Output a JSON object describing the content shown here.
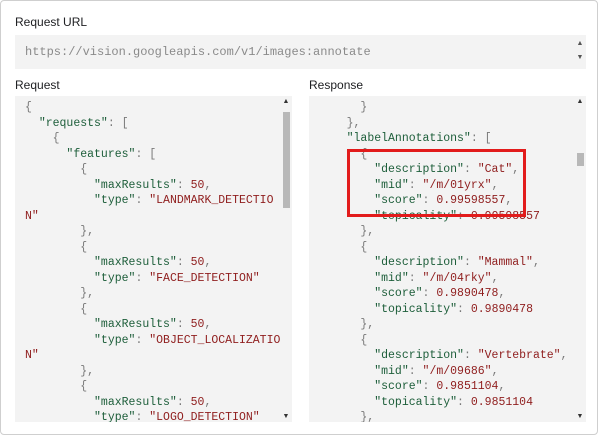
{
  "url_section": {
    "heading": "Request URL",
    "value": "https://vision.googleapis.com/v1/images:annotate"
  },
  "request_section": {
    "heading": "Request",
    "lines": [
      [
        {
          "t": "p",
          "v": "{"
        }
      ],
      [
        {
          "t": "p",
          "v": "  "
        },
        {
          "t": "k",
          "v": "\"requests\""
        },
        {
          "t": "p",
          "v": ": ["
        }
      ],
      [
        {
          "t": "p",
          "v": "    {"
        }
      ],
      [
        {
          "t": "p",
          "v": "      "
        },
        {
          "t": "k",
          "v": "\"features\""
        },
        {
          "t": "p",
          "v": ": ["
        }
      ],
      [
        {
          "t": "p",
          "v": "        {"
        }
      ],
      [
        {
          "t": "p",
          "v": "          "
        },
        {
          "t": "k",
          "v": "\"maxResults\""
        },
        {
          "t": "p",
          "v": ": "
        },
        {
          "t": "n",
          "v": "50"
        },
        {
          "t": "p",
          "v": ","
        }
      ],
      [
        {
          "t": "p",
          "v": "          "
        },
        {
          "t": "k",
          "v": "\"type\""
        },
        {
          "t": "p",
          "v": ": "
        },
        {
          "t": "s",
          "v": "\"LANDMARK_DETECTIO"
        }
      ],
      [
        {
          "t": "s",
          "v": "N\""
        }
      ],
      [
        {
          "t": "p",
          "v": "        },"
        }
      ],
      [
        {
          "t": "p",
          "v": "        {"
        }
      ],
      [
        {
          "t": "p",
          "v": "          "
        },
        {
          "t": "k",
          "v": "\"maxResults\""
        },
        {
          "t": "p",
          "v": ": "
        },
        {
          "t": "n",
          "v": "50"
        },
        {
          "t": "p",
          "v": ","
        }
      ],
      [
        {
          "t": "p",
          "v": "          "
        },
        {
          "t": "k",
          "v": "\"type\""
        },
        {
          "t": "p",
          "v": ": "
        },
        {
          "t": "s",
          "v": "\"FACE_DETECTION\""
        }
      ],
      [
        {
          "t": "p",
          "v": "        },"
        }
      ],
      [
        {
          "t": "p",
          "v": "        {"
        }
      ],
      [
        {
          "t": "p",
          "v": "          "
        },
        {
          "t": "k",
          "v": "\"maxResults\""
        },
        {
          "t": "p",
          "v": ": "
        },
        {
          "t": "n",
          "v": "50"
        },
        {
          "t": "p",
          "v": ","
        }
      ],
      [
        {
          "t": "p",
          "v": "          "
        },
        {
          "t": "k",
          "v": "\"type\""
        },
        {
          "t": "p",
          "v": ": "
        },
        {
          "t": "s",
          "v": "\"OBJECT_LOCALIZATIO"
        }
      ],
      [
        {
          "t": "s",
          "v": "N\""
        }
      ],
      [
        {
          "t": "p",
          "v": "        },"
        }
      ],
      [
        {
          "t": "p",
          "v": "        {"
        }
      ],
      [
        {
          "t": "p",
          "v": "          "
        },
        {
          "t": "k",
          "v": "\"maxResults\""
        },
        {
          "t": "p",
          "v": ": "
        },
        {
          "t": "n",
          "v": "50"
        },
        {
          "t": "p",
          "v": ","
        }
      ],
      [
        {
          "t": "p",
          "v": "          "
        },
        {
          "t": "k",
          "v": "\"type\""
        },
        {
          "t": "p",
          "v": ": "
        },
        {
          "t": "s",
          "v": "\"LOGO_DETECTION\""
        }
      ]
    ]
  },
  "response_section": {
    "heading": "Response",
    "lines": [
      [
        {
          "t": "p",
          "v": "      }"
        }
      ],
      [
        {
          "t": "p",
          "v": "    },"
        }
      ],
      [
        {
          "t": "p",
          "v": "    "
        },
        {
          "t": "k",
          "v": "\"labelAnnotations\""
        },
        {
          "t": "p",
          "v": ": ["
        }
      ],
      [
        {
          "t": "p",
          "v": "      {"
        }
      ],
      [
        {
          "t": "p",
          "v": "        "
        },
        {
          "t": "k",
          "v": "\"description\""
        },
        {
          "t": "p",
          "v": ": "
        },
        {
          "t": "s",
          "v": "\"Cat\""
        },
        {
          "t": "p",
          "v": ","
        }
      ],
      [
        {
          "t": "p",
          "v": "        "
        },
        {
          "t": "k",
          "v": "\"mid\""
        },
        {
          "t": "p",
          "v": ": "
        },
        {
          "t": "s",
          "v": "\"/m/01yrx\""
        },
        {
          "t": "p",
          "v": ","
        }
      ],
      [
        {
          "t": "p",
          "v": "        "
        },
        {
          "t": "k",
          "v": "\"score\""
        },
        {
          "t": "p",
          "v": ": "
        },
        {
          "t": "n",
          "v": "0.99598557"
        },
        {
          "t": "p",
          "v": ","
        }
      ],
      [
        {
          "t": "p",
          "v": "        "
        },
        {
          "t": "k",
          "v": "\"topicality\""
        },
        {
          "t": "p",
          "v": ": "
        },
        {
          "t": "n",
          "v": "0.99598557"
        }
      ],
      [
        {
          "t": "p",
          "v": "      },"
        }
      ],
      [
        {
          "t": "p",
          "v": "      {"
        }
      ],
      [
        {
          "t": "p",
          "v": "        "
        },
        {
          "t": "k",
          "v": "\"description\""
        },
        {
          "t": "p",
          "v": ": "
        },
        {
          "t": "s",
          "v": "\"Mammal\""
        },
        {
          "t": "p",
          "v": ","
        }
      ],
      [
        {
          "t": "p",
          "v": "        "
        },
        {
          "t": "k",
          "v": "\"mid\""
        },
        {
          "t": "p",
          "v": ": "
        },
        {
          "t": "s",
          "v": "\"/m/04rky\""
        },
        {
          "t": "p",
          "v": ","
        }
      ],
      [
        {
          "t": "p",
          "v": "        "
        },
        {
          "t": "k",
          "v": "\"score\""
        },
        {
          "t": "p",
          "v": ": "
        },
        {
          "t": "n",
          "v": "0.9890478"
        },
        {
          "t": "p",
          "v": ","
        }
      ],
      [
        {
          "t": "p",
          "v": "        "
        },
        {
          "t": "k",
          "v": "\"topicality\""
        },
        {
          "t": "p",
          "v": ": "
        },
        {
          "t": "n",
          "v": "0.9890478"
        }
      ],
      [
        {
          "t": "p",
          "v": "      },"
        }
      ],
      [
        {
          "t": "p",
          "v": "      {"
        }
      ],
      [
        {
          "t": "p",
          "v": "        "
        },
        {
          "t": "k",
          "v": "\"description\""
        },
        {
          "t": "p",
          "v": ": "
        },
        {
          "t": "s",
          "v": "\"Vertebrate\""
        },
        {
          "t": "p",
          "v": ","
        }
      ],
      [
        {
          "t": "p",
          "v": "        "
        },
        {
          "t": "k",
          "v": "\"mid\""
        },
        {
          "t": "p",
          "v": ": "
        },
        {
          "t": "s",
          "v": "\"/m/09686\""
        },
        {
          "t": "p",
          "v": ","
        }
      ],
      [
        {
          "t": "p",
          "v": "        "
        },
        {
          "t": "k",
          "v": "\"score\""
        },
        {
          "t": "p",
          "v": ": "
        },
        {
          "t": "n",
          "v": "0.9851104"
        },
        {
          "t": "p",
          "v": ","
        }
      ],
      [
        {
          "t": "p",
          "v": "        "
        },
        {
          "t": "k",
          "v": "\"topicality\""
        },
        {
          "t": "p",
          "v": ": "
        },
        {
          "t": "n",
          "v": "0.9851104"
        }
      ],
      [
        {
          "t": "p",
          "v": "      },"
        }
      ],
      [
        {
          "t": "p",
          "v": "      {"
        }
      ]
    ]
  },
  "colors": {
    "key": "#1d5e3a",
    "string": "#8f1d1d",
    "punctuation": "#7a7a7a",
    "highlight": "#e21b1b",
    "panel_bg": "#f3f3f3"
  },
  "icons": {
    "scroll_up": "scroll-up-arrow-icon",
    "scroll_down": "scroll-down-arrow-icon"
  }
}
